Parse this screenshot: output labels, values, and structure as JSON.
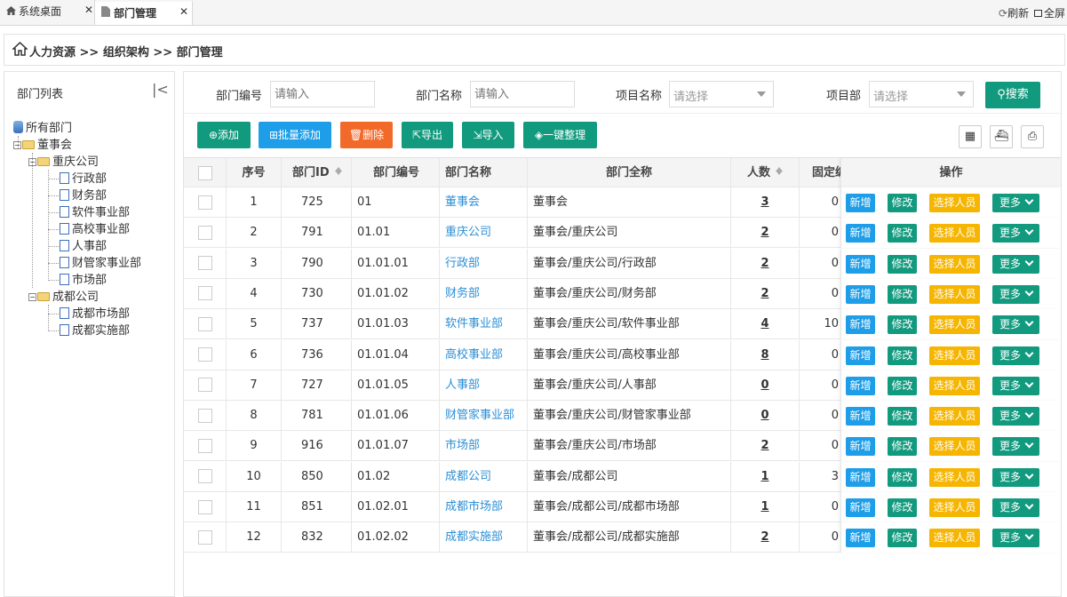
{
  "tabs": [
    {
      "label": "系统桌面",
      "icon": "home-icon"
    },
    {
      "label": "部门管理",
      "icon": "document-icon"
    }
  ],
  "top_actions": {
    "refresh": "刷新",
    "fullscreen": "全屏"
  },
  "breadcrumb": "人力资源 >> 组织架构 >> 部门管理",
  "left_panel": {
    "title": "部门列表",
    "tree": [
      {
        "label": "所有部门",
        "icon": "database-icon"
      },
      {
        "label": "董事会",
        "icon": "folder-icon"
      },
      {
        "label": "重庆公司",
        "icon": "folder-icon"
      },
      {
        "label": "行政部",
        "icon": "page-icon"
      },
      {
        "label": "财务部",
        "icon": "page-icon"
      },
      {
        "label": "软件事业部",
        "icon": "page-icon"
      },
      {
        "label": "高校事业部",
        "icon": "page-icon"
      },
      {
        "label": "人事部",
        "icon": "page-icon"
      },
      {
        "label": "财管家事业部",
        "icon": "page-icon"
      },
      {
        "label": "市场部",
        "icon": "page-icon"
      },
      {
        "label": "成都公司",
        "icon": "folder-icon"
      },
      {
        "label": "成都市场部",
        "icon": "page-icon"
      },
      {
        "label": "成都实施部",
        "icon": "page-icon"
      }
    ]
  },
  "filters": {
    "dept_code": {
      "label": "部门编号",
      "placeholder": "请输入"
    },
    "dept_name": {
      "label": "部门名称",
      "placeholder": "请输入"
    },
    "project_name": {
      "label": "项目名称",
      "placeholder": "请选择"
    },
    "project_dept": {
      "label": "项目部",
      "placeholder": "请选择"
    },
    "search_label": "搜索"
  },
  "actions": {
    "add": "添加",
    "batch_add": "批量添加",
    "delete": "删除",
    "export": "导出",
    "import": "导入",
    "organize": "一键整理"
  },
  "colors": {
    "green": "#129a7e",
    "blue": "#1e9ee8",
    "orange": "#f26a2a",
    "yellow": "#f6b500",
    "link": "#2d8fd5"
  },
  "table": {
    "headers": [
      "序号",
      "部门ID",
      "部门编号",
      "部门名称",
      "部门全称",
      "人数",
      "固定编",
      "操作"
    ],
    "row_actions": {
      "add": "新增",
      "edit": "修改",
      "select": "选择人员",
      "more": "更多"
    },
    "rows": [
      {
        "no": "1",
        "id": "725",
        "code": "01",
        "name": "董事会",
        "full": "董事会",
        "count": "3",
        "fixed": "0"
      },
      {
        "no": "2",
        "id": "791",
        "code": "01.01",
        "name": "重庆公司",
        "full": "董事会/重庆公司",
        "count": "2",
        "fixed": "0"
      },
      {
        "no": "3",
        "id": "790",
        "code": "01.01.01",
        "name": "行政部",
        "full": "董事会/重庆公司/行政部",
        "count": "2",
        "fixed": "0"
      },
      {
        "no": "4",
        "id": "730",
        "code": "01.01.02",
        "name": "财务部",
        "full": "董事会/重庆公司/财务部",
        "count": "2",
        "fixed": "0"
      },
      {
        "no": "5",
        "id": "737",
        "code": "01.01.03",
        "name": "软件事业部",
        "full": "董事会/重庆公司/软件事业部",
        "count": "4",
        "fixed": "10"
      },
      {
        "no": "6",
        "id": "736",
        "code": "01.01.04",
        "name": "高校事业部",
        "full": "董事会/重庆公司/高校事业部",
        "count": "8",
        "fixed": "0"
      },
      {
        "no": "7",
        "id": "727",
        "code": "01.01.05",
        "name": "人事部",
        "full": "董事会/重庆公司/人事部",
        "count": "0",
        "fixed": "0"
      },
      {
        "no": "8",
        "id": "781",
        "code": "01.01.06",
        "name": "财管家事业部",
        "full": "董事会/重庆公司/财管家事业部",
        "count": "0",
        "fixed": "0"
      },
      {
        "no": "9",
        "id": "916",
        "code": "01.01.07",
        "name": "市场部",
        "full": "董事会/重庆公司/市场部",
        "count": "2",
        "fixed": "0"
      },
      {
        "no": "10",
        "id": "850",
        "code": "01.02",
        "name": "成都公司",
        "full": "董事会/成都公司",
        "count": "1",
        "fixed": "3"
      },
      {
        "no": "11",
        "id": "851",
        "code": "01.02.01",
        "name": "成都市场部",
        "full": "董事会/成都公司/成都市场部",
        "count": "1",
        "fixed": "0"
      },
      {
        "no": "12",
        "id": "832",
        "code": "01.02.02",
        "name": "成都实施部",
        "full": "董事会/成都公司/成都实施部",
        "count": "2",
        "fixed": "0"
      }
    ]
  }
}
